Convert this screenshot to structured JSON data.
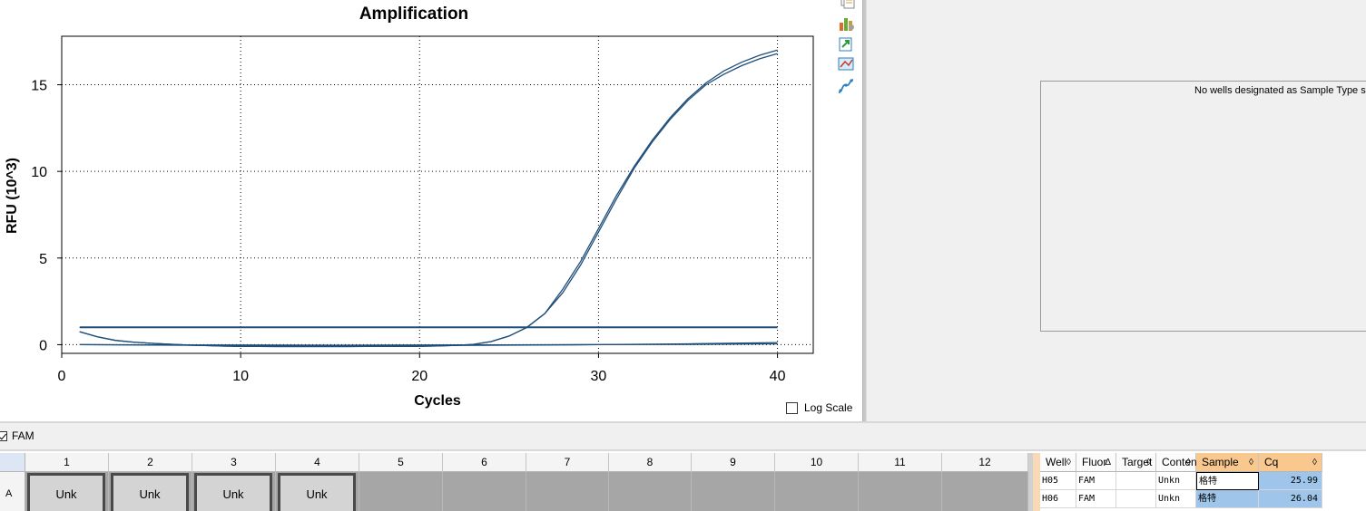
{
  "chart": {
    "title": "Amplification",
    "xlabel": "Cycles",
    "ylabel": "RFU (10^3)",
    "log_scale_label": "Log Scale",
    "log_scale_checked": false
  },
  "chart_data": {
    "type": "line",
    "title": "Amplification",
    "xlabel": "Cycles",
    "ylabel": "RFU (10^3)",
    "xlim": [
      0,
      42
    ],
    "ylim": [
      -0.5,
      17.8
    ],
    "xticks": [
      0,
      10,
      20,
      30,
      40
    ],
    "yticks": [
      0,
      5,
      10,
      15
    ],
    "grid": true,
    "line_color": "#1f4e79",
    "threshold": 1.0,
    "threshold_range": [
      1,
      40
    ],
    "series": [
      {
        "x": [
          1,
          2,
          3,
          4,
          5,
          6,
          7,
          8,
          9,
          10,
          11,
          12,
          13,
          14,
          15,
          16,
          17,
          18,
          19,
          20,
          21,
          22,
          23,
          24,
          25,
          26,
          27,
          28,
          29,
          30,
          31,
          32,
          33,
          34,
          35,
          36,
          37,
          38,
          39,
          40
        ],
        "values": [
          0.75,
          0.45,
          0.25,
          0.15,
          0.08,
          0.03,
          -0.02,
          -0.05,
          -0.08,
          -0.1,
          -0.1,
          -0.11,
          -0.11,
          -0.11,
          -0.11,
          -0.11,
          -0.1,
          -0.1,
          -0.1,
          -0.09,
          -0.07,
          -0.04,
          0.02,
          0.18,
          0.5,
          1.0,
          1.8,
          3.0,
          4.6,
          6.5,
          8.4,
          10.2,
          11.7,
          13.0,
          14.1,
          15.0,
          15.6,
          16.1,
          16.5,
          16.8
        ]
      },
      {
        "x": [
          1,
          2,
          3,
          4,
          5,
          6,
          7,
          8,
          9,
          10,
          11,
          12,
          13,
          14,
          15,
          16,
          17,
          18,
          19,
          20,
          21,
          22,
          23,
          24,
          25,
          26,
          27,
          28,
          29,
          30,
          31,
          32,
          33,
          34,
          35,
          36,
          37,
          38,
          39,
          40
        ],
        "values": [
          0.75,
          0.45,
          0.25,
          0.15,
          0.08,
          0.03,
          -0.02,
          -0.05,
          -0.08,
          -0.1,
          -0.1,
          -0.11,
          -0.11,
          -0.11,
          -0.11,
          -0.11,
          -0.1,
          -0.1,
          -0.1,
          -0.09,
          -0.07,
          -0.04,
          0.02,
          0.18,
          0.5,
          1.0,
          1.8,
          3.2,
          4.8,
          6.7,
          8.6,
          10.3,
          11.8,
          13.1,
          14.2,
          15.1,
          15.8,
          16.3,
          16.7,
          17.0
        ]
      },
      {
        "x": [
          1,
          5,
          10,
          15,
          20,
          25,
          30,
          35,
          40
        ],
        "values": [
          0.0,
          -0.02,
          -0.05,
          -0.06,
          -0.05,
          -0.03,
          0.0,
          0.02,
          0.05
        ]
      },
      {
        "x": [
          1,
          5,
          10,
          15,
          20,
          25,
          30,
          35,
          40
        ],
        "values": [
          0.0,
          -0.01,
          -0.02,
          -0.03,
          -0.02,
          -0.01,
          0.0,
          0.05,
          0.12
        ]
      }
    ]
  },
  "toolbar": {
    "icons": [
      "copy-icon",
      "chart-options-icon",
      "export-icon",
      "display-options-icon",
      "curve-icon"
    ]
  },
  "standard_curve": {
    "message": "No wells designated as Sample Type sta"
  },
  "fluor_filter": {
    "label": "FAM",
    "checked": true
  },
  "plate": {
    "columns": [
      "1",
      "2",
      "3",
      "4",
      "5",
      "6",
      "7",
      "8",
      "9",
      "10",
      "11",
      "12"
    ],
    "row_label": "A",
    "wells": [
      "Unk",
      "Unk",
      "Unk",
      "Unk",
      "",
      "",
      "",
      "",
      "",
      "",
      "",
      ""
    ]
  },
  "results_table": {
    "headers": [
      "Well",
      "Fluor",
      "Target",
      "Content",
      "Sample",
      "Cq"
    ],
    "sort_marks": [
      "◊",
      "Δ",
      "◊",
      "◊",
      "◊",
      "◊"
    ],
    "rows": [
      {
        "well": "H05",
        "fluor": "FAM",
        "target": "",
        "content": "Unkn",
        "sample": "格特",
        "cq": "25.99"
      },
      {
        "well": "H06",
        "fluor": "FAM",
        "target": "",
        "content": "Unkn",
        "sample": "格特",
        "cq": "26.04"
      }
    ]
  }
}
